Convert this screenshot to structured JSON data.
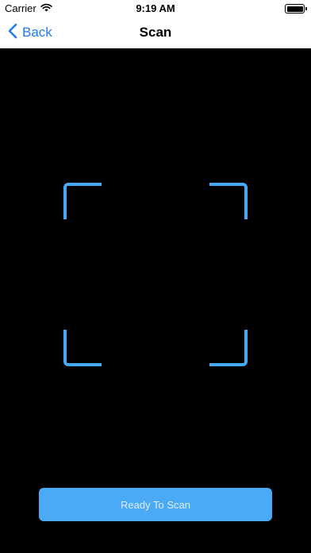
{
  "status_bar": {
    "carrier": "Carrier",
    "time": "9:19 AM",
    "icons": [
      "wifi-icon",
      "battery-icon"
    ]
  },
  "nav": {
    "back_label": "Back",
    "title": "Scan"
  },
  "scanner": {
    "button_label": "Ready To Scan",
    "accent_color": "#46a9f6",
    "background_color": "#000000"
  }
}
